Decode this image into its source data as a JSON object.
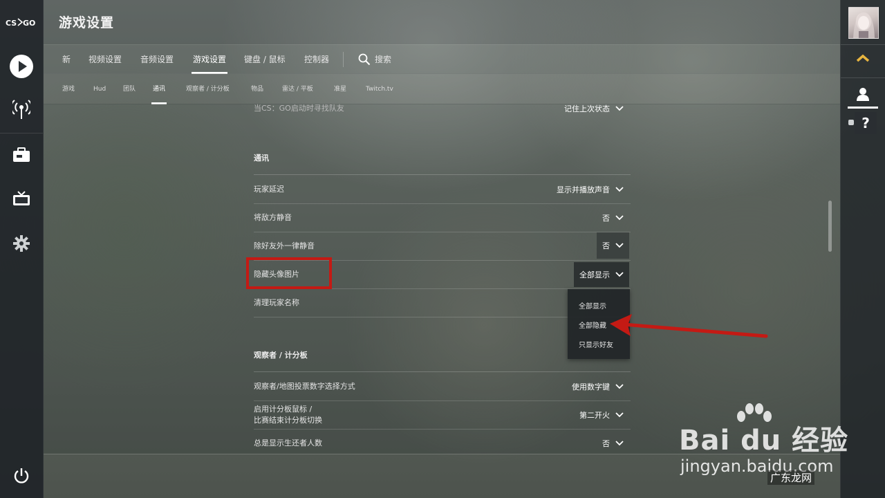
{
  "app": {
    "logo_text": "CS:GO",
    "page_title": "游戏设置"
  },
  "tabs": [
    {
      "label": "新",
      "active": false
    },
    {
      "label": "视频设置",
      "active": false
    },
    {
      "label": "音频设置",
      "active": false
    },
    {
      "label": "游戏设置",
      "active": true
    },
    {
      "label": "键盘 / 鼠标",
      "active": false
    },
    {
      "label": "控制器",
      "active": false
    }
  ],
  "search_label": "搜索",
  "subtabs": [
    {
      "label": "游戏",
      "active": false
    },
    {
      "label": "Hud",
      "active": false
    },
    {
      "label": "团队",
      "active": false
    },
    {
      "label": "通讯",
      "active": true
    },
    {
      "label": "观察者 / 计分板",
      "active": false
    },
    {
      "label": "物品",
      "active": false
    },
    {
      "label": "雷达 / 平板",
      "active": false
    },
    {
      "label": "准星",
      "active": false
    },
    {
      "label": "Twitch.tv",
      "active": false
    }
  ],
  "settings": {
    "top_row": {
      "label": "当CS：GO启动时寻找队友",
      "value": "记住上次状态"
    },
    "comm_section_title": "通讯",
    "comm_rows": [
      {
        "label": "玩家延迟",
        "value": "显示并播放声音"
      },
      {
        "label": "将敌方静音",
        "value": "否"
      },
      {
        "label": "除好友外一律静音",
        "value": "否"
      },
      {
        "label": "隐藏头像图片",
        "value": "全部显示"
      },
      {
        "label": "清理玩家名称",
        "value": ""
      }
    ],
    "dropdown_options": [
      "全部显示",
      "全部隐藏",
      "只显示好友"
    ],
    "spectator_section_title": "观察者 / 计分板",
    "spectator_rows": [
      {
        "label": "观察者/地图投票数字选择方式",
        "value": "使用数字键"
      },
      {
        "label_line1": "启用计分板鼠标 /",
        "label_line2": "比赛结束计分板切换",
        "value": "第二开火"
      },
      {
        "label": "总是显示生还者人数",
        "value": "否"
      }
    ]
  },
  "annotation": {
    "color": "#c41a14"
  },
  "watermark": {
    "brand": "Bai du 经验",
    "url": "jingyan.baidu.com",
    "site": "广东龙网"
  },
  "colors": {
    "accent": "#ffffff",
    "rank": "#e8b540",
    "annotation": "#c41a14"
  }
}
